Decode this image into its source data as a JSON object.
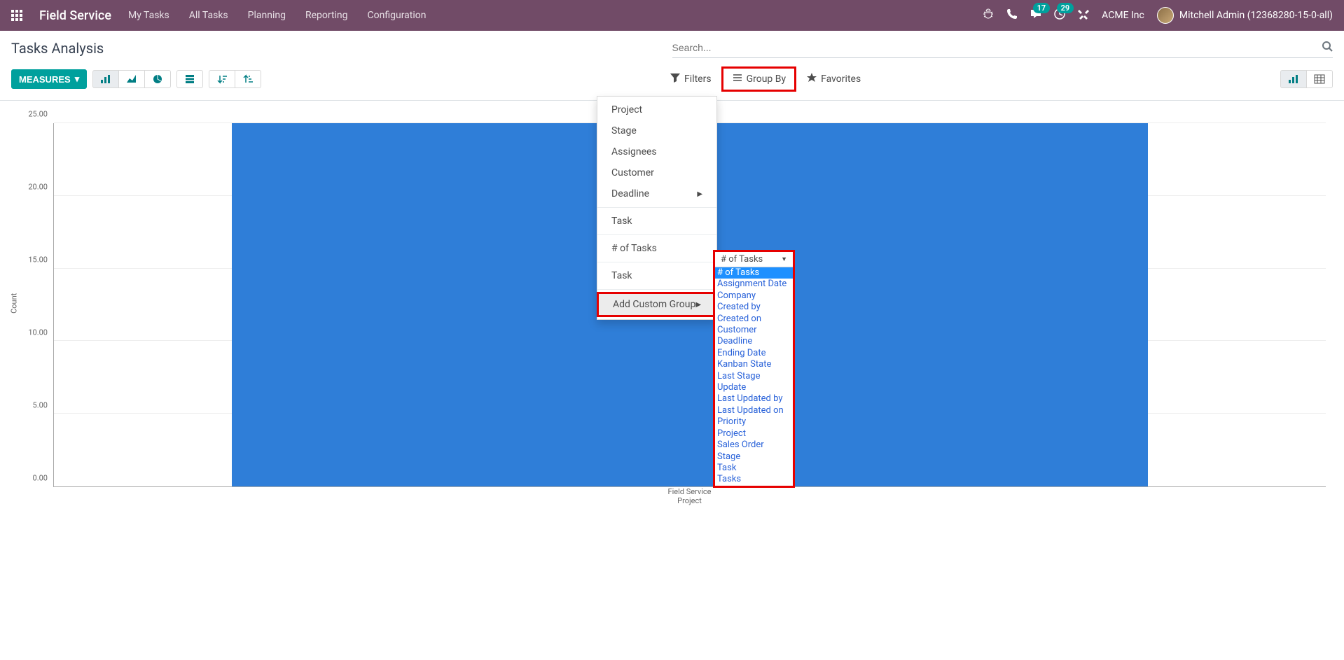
{
  "navbar": {
    "app_title": "Field Service",
    "links": [
      "My Tasks",
      "All Tasks",
      "Planning",
      "Reporting",
      "Configuration"
    ],
    "msg_badge": "17",
    "activity_badge": "29",
    "company": "ACME Inc",
    "user": "Mitchell Admin (12368280-15-0-all)"
  },
  "page": {
    "title": "Tasks Analysis",
    "search_placeholder": "Search..."
  },
  "controls": {
    "measures": "MEASURES",
    "filters": "Filters",
    "group_by": "Group By",
    "favorites": "Favorites"
  },
  "group_by_menu": {
    "items1": [
      "Project",
      "Stage",
      "Assignees",
      "Customer"
    ],
    "deadline": "Deadline",
    "items2": [
      "Task"
    ],
    "items3": [
      "# of Tasks"
    ],
    "items4": [
      "Task"
    ],
    "add_custom": "Add Custom Group"
  },
  "custom_group": {
    "selected": "# of Tasks",
    "options": [
      "# of Tasks",
      "Assignment Date",
      "Company",
      "Created by",
      "Created on",
      "Customer",
      "Deadline",
      "Ending Date",
      "Kanban State",
      "Last Stage Update",
      "Last Updated by",
      "Last Updated on",
      "Priority",
      "Project",
      "Sales Order",
      "Stage",
      "Task",
      "Tasks"
    ]
  },
  "chart_data": {
    "type": "bar",
    "title": "",
    "categories": [
      "Field Service"
    ],
    "values": [
      25
    ],
    "ylabel": "Count",
    "xlabel": "Project",
    "ylim": [
      0,
      25
    ],
    "yticks": [
      "0.00",
      "5.00",
      "10.00",
      "15.00",
      "20.00",
      "25.00"
    ],
    "legend": "Count"
  },
  "colors": {
    "bar": "#2f7ed8",
    "nav": "#714b67",
    "primary": "#00a09d",
    "highlight": "#e60000"
  }
}
